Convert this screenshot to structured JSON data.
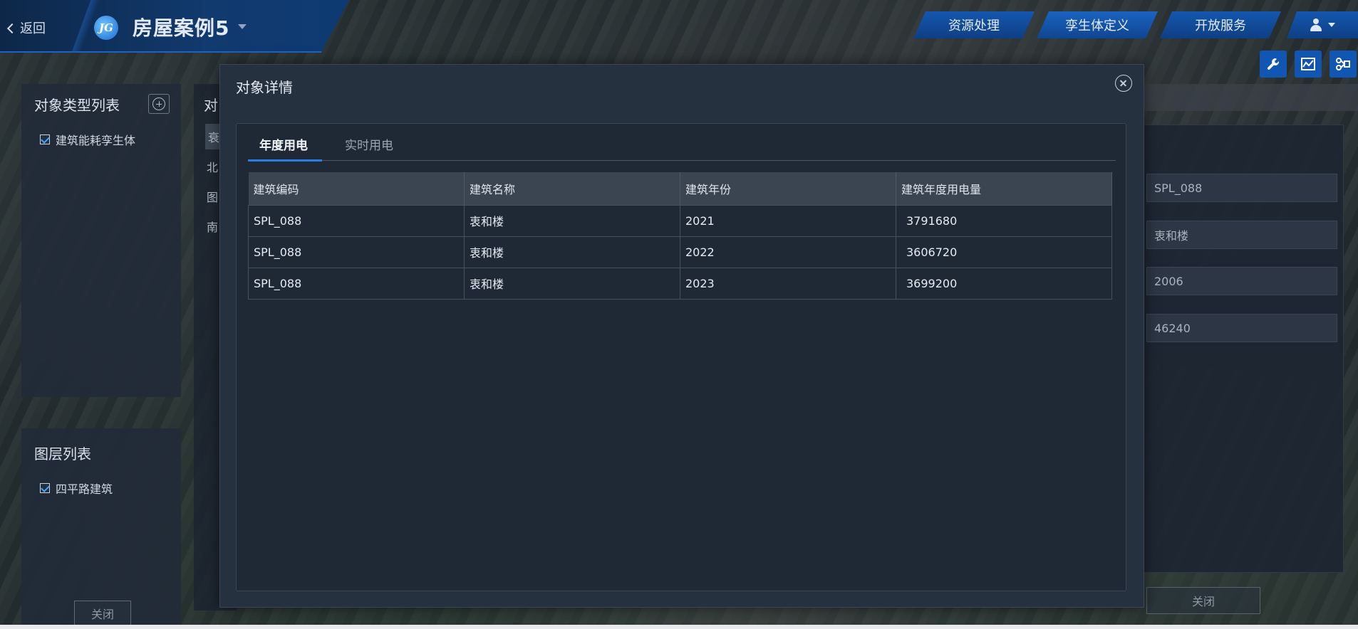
{
  "header": {
    "back_label": "返回",
    "logo_text": "JG",
    "app_title": "房屋案例5",
    "nav_tabs": [
      "资源处理",
      "孪生体定义",
      "开放服务"
    ]
  },
  "left_panel_types": {
    "title": "对象类型列表",
    "items": [
      "建筑能耗孪生体"
    ]
  },
  "left_panel_layers": {
    "title": "图层列表",
    "items": [
      "四平路建筑"
    ],
    "close_label": "关闭"
  },
  "middle_panel": {
    "title": "对",
    "items": [
      "衰",
      "北",
      "图",
      "南"
    ]
  },
  "right_panel": {
    "fields": [
      "SPL_088",
      "衷和楼",
      "2006",
      "46240"
    ],
    "close_label": "关闭"
  },
  "modal": {
    "title": "对象详情",
    "tabs": [
      "年度用电",
      "实时用电"
    ],
    "table": {
      "headers": [
        "建筑编码",
        "建筑名称",
        "建筑年份",
        "建筑年度用电量"
      ],
      "rows": [
        [
          "SPL_088",
          "衷和楼",
          "2021",
          "3791680"
        ],
        [
          "SPL_088",
          "衷和楼",
          "2022",
          "3606720"
        ],
        [
          "SPL_088",
          "衷和楼",
          "2023",
          "3699200"
        ]
      ]
    }
  },
  "icons": {
    "toolbar": [
      "wrench-icon",
      "chart-icon",
      "flow-icon"
    ]
  },
  "colors": {
    "accent": "#1457b0",
    "tab_underline": "#2b7ce8",
    "checkbox_check": "#4aa3ff"
  }
}
